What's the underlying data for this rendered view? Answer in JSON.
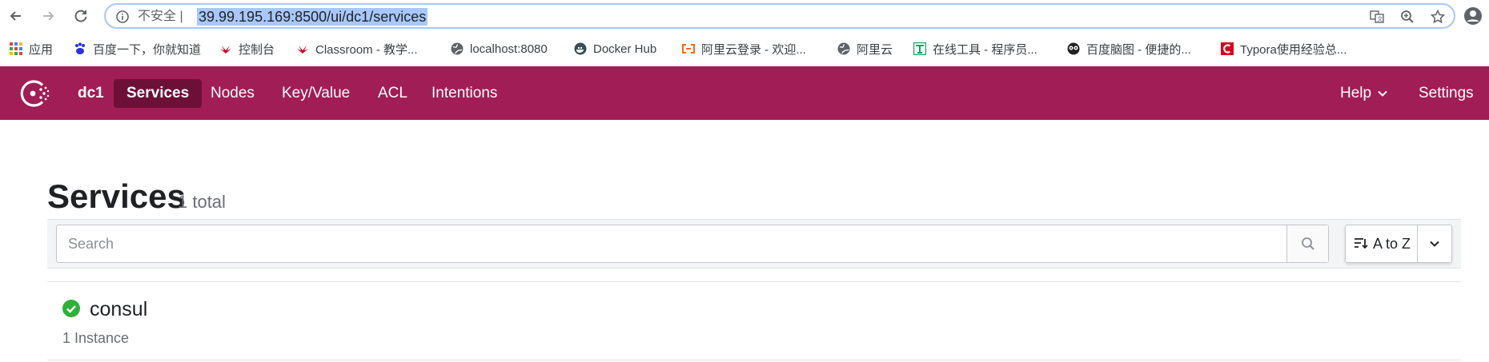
{
  "browser": {
    "insecure_label": "不安全",
    "url": "39.99.195.169:8500/ui/dc1/services",
    "bookmarks": [
      {
        "label": "应用",
        "icon": "apps-grid-icon"
      },
      {
        "label": "百度一下，你就知道",
        "icon": "baidu-icon"
      },
      {
        "label": "控制台",
        "icon": "huawei-icon"
      },
      {
        "label": "Classroom - 教学...",
        "icon": "huawei-icon"
      },
      {
        "label": "localhost:8080",
        "icon": "globe-icon"
      },
      {
        "label": "Docker Hub",
        "icon": "docker-icon"
      },
      {
        "label": "阿里云登录 - 欢迎...",
        "icon": "aliyun-icon"
      },
      {
        "label": "阿里云",
        "icon": "globe-icon"
      },
      {
        "label": "在线工具 - 程序员...",
        "icon": "tool-icon"
      },
      {
        "label": "百度脑图 - 便捷的...",
        "icon": "owl-icon"
      },
      {
        "label": "Typora使用经验总...",
        "icon": "typora-icon"
      }
    ]
  },
  "nav": {
    "datacenter": "dc1",
    "items": [
      {
        "label": "Services",
        "active": true
      },
      {
        "label": "Nodes",
        "active": false
      },
      {
        "label": "Key/Value",
        "active": false
      },
      {
        "label": "ACL",
        "active": false
      },
      {
        "label": "Intentions",
        "active": false
      }
    ],
    "help_label": "Help",
    "settings_label": "Settings"
  },
  "page": {
    "title": "Services",
    "count": "1 total"
  },
  "toolbar": {
    "search_placeholder": "Search",
    "search_value": "",
    "sort_label": "A to Z"
  },
  "services": [
    {
      "name": "consul",
      "instances": "1 Instance",
      "status": "passing"
    }
  ],
  "colors": {
    "brand": "#a11d55",
    "brand_active": "#6d1038",
    "passing": "#2eb039",
    "url_highlight": "#a8c8fb"
  }
}
